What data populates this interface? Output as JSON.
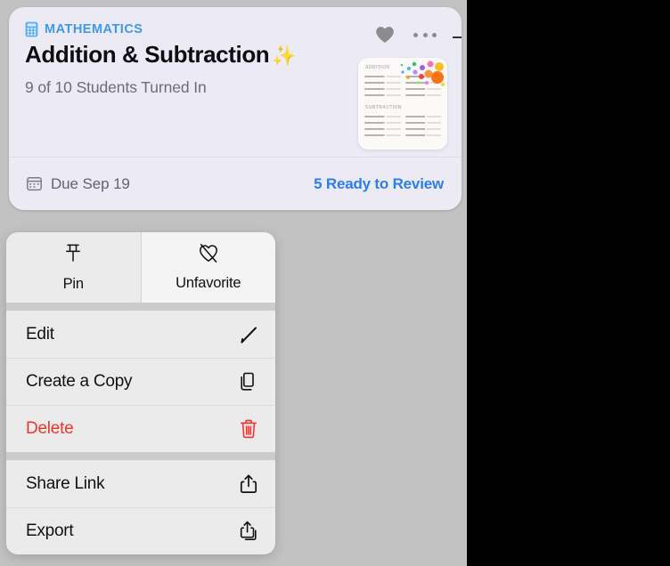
{
  "page": {
    "background_color": "#c2c2c2",
    "right_panel_color": "#000000"
  },
  "assignment_card": {
    "background_color": "#eceaf5",
    "subject": {
      "label": "MATHEMATICS",
      "color": "#3c9bf0",
      "icon": "calculator-icon"
    },
    "title": "Addition & Subtraction",
    "title_emoji": "✨",
    "subtitle": "9 of 10 Students Turned In",
    "favorite_icon": "heart-filled-icon",
    "more_icon": "ellipsis-icon",
    "thumbnail": {
      "name": "worksheet-thumbnail",
      "section_one": "ADDITION",
      "section_two": "SUBTRACTION"
    },
    "footer": {
      "due_icon": "calendar-icon",
      "due_text": "Due Sep 19",
      "review_link": "5 Ready to Review",
      "review_link_color": "#2d7ff0"
    }
  },
  "context_menu": {
    "top_actions": [
      {
        "label": "Pin",
        "icon": "pin-icon",
        "highlighted": false
      },
      {
        "label": "Unfavorite",
        "icon": "heart-slash-icon",
        "highlighted": true
      }
    ],
    "groups": [
      {
        "items": [
          {
            "label": "Edit",
            "icon": "pencil-icon",
            "destructive": false
          },
          {
            "label": "Create a Copy",
            "icon": "duplicate-icon",
            "destructive": false
          },
          {
            "label": "Delete",
            "icon": "trash-icon",
            "destructive": true,
            "color": "#f5342c"
          }
        ]
      },
      {
        "items": [
          {
            "label": "Share Link",
            "icon": "share-icon",
            "destructive": false
          },
          {
            "label": "Export",
            "icon": "export-icon",
            "destructive": false
          }
        ]
      }
    ]
  }
}
